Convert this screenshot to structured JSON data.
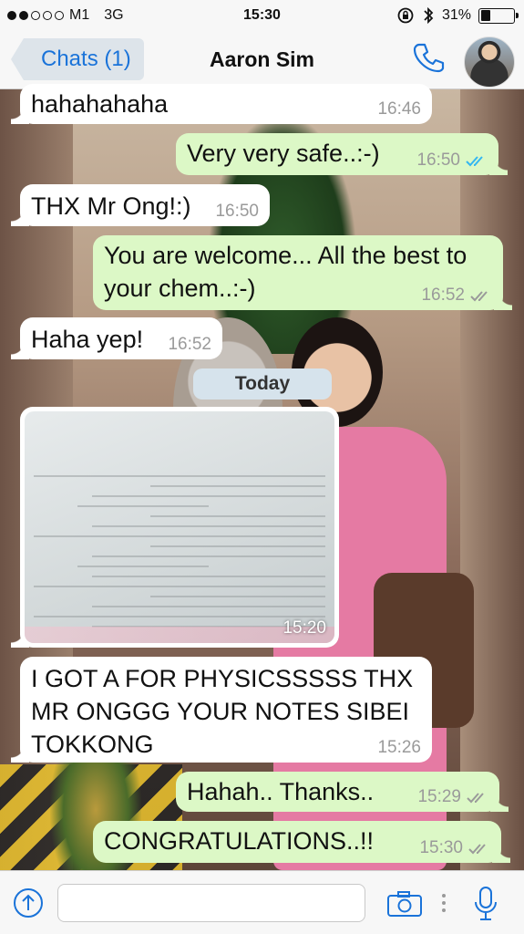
{
  "status_bar": {
    "carrier": "M1",
    "network": "3G",
    "time": "15:30",
    "battery": "31%",
    "battery_level": 0.31,
    "signal_bars": 2
  },
  "header": {
    "back_label": "Chats (1)",
    "contact_name": "Aaron Sim"
  },
  "messages": [
    {
      "dir": "in",
      "text": "hahahahaha",
      "time": "16:46"
    },
    {
      "dir": "out",
      "text": "Very very safe..:-)",
      "time": "16:50",
      "status": "read"
    },
    {
      "dir": "in",
      "text": "THX Mr Ong!:)",
      "time": "16:50"
    },
    {
      "dir": "out",
      "text": "You are welcome... All the best to your chem..:-)",
      "time": "16:52",
      "status": "delivered"
    },
    {
      "dir": "in",
      "text": "Haha yep!",
      "time": "16:52"
    },
    {
      "dir": "in",
      "type": "image",
      "time": "15:20"
    },
    {
      "dir": "in",
      "text": "I GOT A FOR PHYSICSSSSS THX MR ONGGG YOUR NOTES SIBEI TOKKONG",
      "time": "15:26"
    },
    {
      "dir": "out",
      "text": "Hahah.. Thanks..",
      "time": "15:29",
      "status": "delivered"
    },
    {
      "dir": "out",
      "text": "CONGRATULATIONS..!!",
      "time": "15:30",
      "status": "delivered"
    }
  ],
  "date_divider": "Today",
  "input": {
    "value": ""
  },
  "colors": {
    "accent": "#1a73d9",
    "outgoing_bubble": "#dcf8c6",
    "incoming_bubble": "#ffffff",
    "read_tick": "#34b7f1",
    "delivered_tick": "#9a9a9a"
  }
}
